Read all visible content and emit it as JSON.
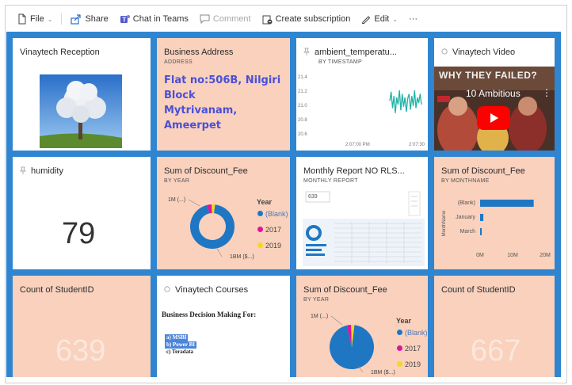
{
  "toolbar": {
    "file": "File",
    "share": "Share",
    "chat": "Chat in Teams",
    "comment": "Comment",
    "subscription": "Create subscription",
    "edit": "Edit",
    "more": "···"
  },
  "colors": {
    "canvas": "#2f85d0",
    "peach": "#f9d1bd",
    "accent_blue": "#1f77c4",
    "magenta": "#e0139c",
    "yellow": "#f6d624",
    "link_purple": "#4b4fd6"
  },
  "tiles": {
    "reception": {
      "title": "Vinaytech Reception"
    },
    "address": {
      "title": "Business Address",
      "sub": "ADDRESS",
      "line1": "Flat no:506B, Nilgiri Block",
      "line2": "Mytrivanam, Ameerpet"
    },
    "ambient": {
      "title": "ambient_temperatu...",
      "sub": "BY TIMESTAMP"
    },
    "video": {
      "title": "Vinaytech Video",
      "caption": "10 Ambitious",
      "banner": "WHY THEY FAILED?"
    },
    "humidity": {
      "title": "humidity",
      "value": "79"
    },
    "discount1": {
      "title": "Sum of Discount_Fee",
      "sub": "BY YEAR"
    },
    "monthly": {
      "title": "Monthly Report NO RLS...",
      "sub": "MONTHLY REPORT",
      "badge": "639"
    },
    "discount_month": {
      "title": "Sum of Discount_Fee",
      "sub": "BY MONTHNAME",
      "axis_title": "MonthName"
    },
    "students1": {
      "title": "Count of StudentID",
      "value": "639"
    },
    "courses": {
      "title": "Vinaytech Courses",
      "heading": "Business Decision Making For:",
      "items": [
        "a) MSBI",
        "b) Power BI",
        "c) Teradata"
      ]
    },
    "discount2": {
      "title": "Sum of Discount_Fee",
      "sub": "BY YEAR"
    },
    "students2": {
      "title": "Count of StudentID",
      "value": "667"
    }
  },
  "legend": {
    "title": "Year",
    "items": [
      "(Blank)",
      "2017",
      "2019"
    ]
  },
  "chart_data": [
    {
      "type": "line",
      "title": "ambient_temperatu...",
      "subtitle": "BY TIMESTAMP",
      "y_ticks": [
        "21.4",
        "21.2",
        "21.0",
        "20.8",
        "20.6"
      ],
      "x_ticks": [
        "2:07:00 PM",
        "2:07:30"
      ],
      "ylim": [
        20.6,
        21.4
      ],
      "x": [
        0,
        1,
        2,
        3,
        4,
        5,
        6,
        7,
        8,
        9,
        10,
        11,
        12,
        13,
        14,
        15,
        16,
        17,
        18,
        19,
        20,
        21,
        22,
        23
      ],
      "values": [
        21.05,
        21.18,
        20.95,
        21.12,
        20.88,
        21.1,
        21.0,
        21.2,
        20.92,
        21.15,
        20.97,
        21.1,
        20.9,
        21.08,
        21.15,
        20.93,
        21.12,
        20.98,
        21.2,
        20.95,
        21.1,
        21.02,
        21.15,
        21.0
      ]
    },
    {
      "type": "pie",
      "title": "Sum of Discount_Fee",
      "subtitle": "BY YEAR",
      "donut": true,
      "labels": [
        "(Blank)",
        "2017",
        "2019"
      ],
      "values": [
        1800000,
        60000,
        45000
      ],
      "data_labels": [
        "1M (...)",
        "1BM ($...)"
      ]
    },
    {
      "type": "bar",
      "orientation": "horizontal",
      "title": "Sum of Discount_Fee",
      "subtitle": "BY MONTHNAME",
      "categories": [
        "(Blank)",
        "January",
        "March"
      ],
      "values": [
        16500000,
        1000000,
        500000
      ],
      "x_ticks": [
        "0M",
        "10M",
        "20M"
      ],
      "xlim": [
        0,
        20000000
      ],
      "ylabel": "MonthName"
    },
    {
      "type": "pie",
      "title": "Sum of Discount_Fee",
      "subtitle": "BY YEAR",
      "donut": false,
      "labels": [
        "(Blank)",
        "2017",
        "2019"
      ],
      "values": [
        1800000,
        60000,
        45000
      ],
      "data_labels": [
        "1M (...)",
        "1BM ($...)"
      ]
    }
  ]
}
